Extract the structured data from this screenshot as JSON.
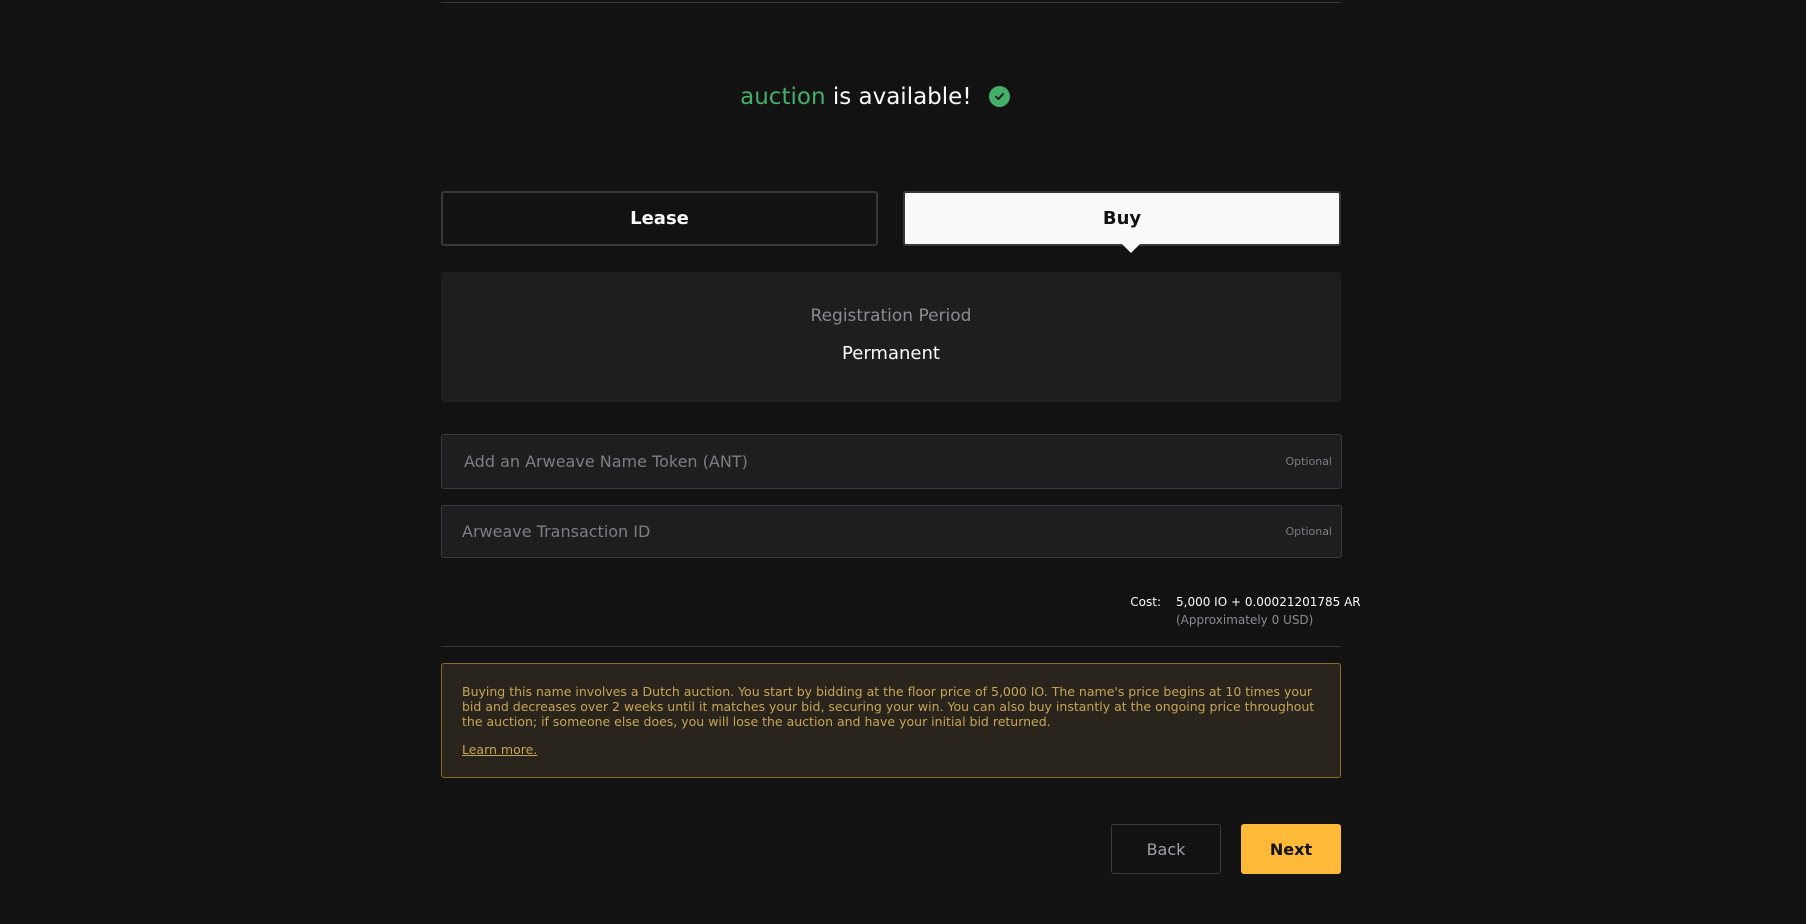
{
  "availability": {
    "name": "auction",
    "suffix": "is available!",
    "icon": "check-circle-icon",
    "accent_color": "#44af69"
  },
  "tabs": {
    "lease_label": "Lease",
    "buy_label": "Buy",
    "selected": "Buy"
  },
  "registration": {
    "label": "Registration Period",
    "value": "Permanent"
  },
  "fields": {
    "ant": {
      "placeholder": "Add an Arweave Name Token (ANT)",
      "value": "",
      "optional_label": "Optional"
    },
    "transaction": {
      "placeholder": "Arweave Transaction ID",
      "value": "",
      "optional_label": "Optional"
    }
  },
  "cost": {
    "label": "Cost:",
    "value": "5,000 IO + 0.00021201785 AR",
    "usd": "(Approximately 0 USD)"
  },
  "notice": {
    "text": "Buying this name involves a Dutch auction. You start by bidding at the floor price of 5,000 IO. The name's price begins at 10 times your bid and decreases over 2 weeks until it matches your bid, securing your win. You can also buy instantly at the ongoing price throughout the auction; if someone else does, you will lose the auction and have your initial bid returned.",
    "link_label": "Learn more.",
    "color": "#c7a455"
  },
  "actions": {
    "back_label": "Back",
    "next_label": "Next",
    "next_color": "#ffb938"
  }
}
